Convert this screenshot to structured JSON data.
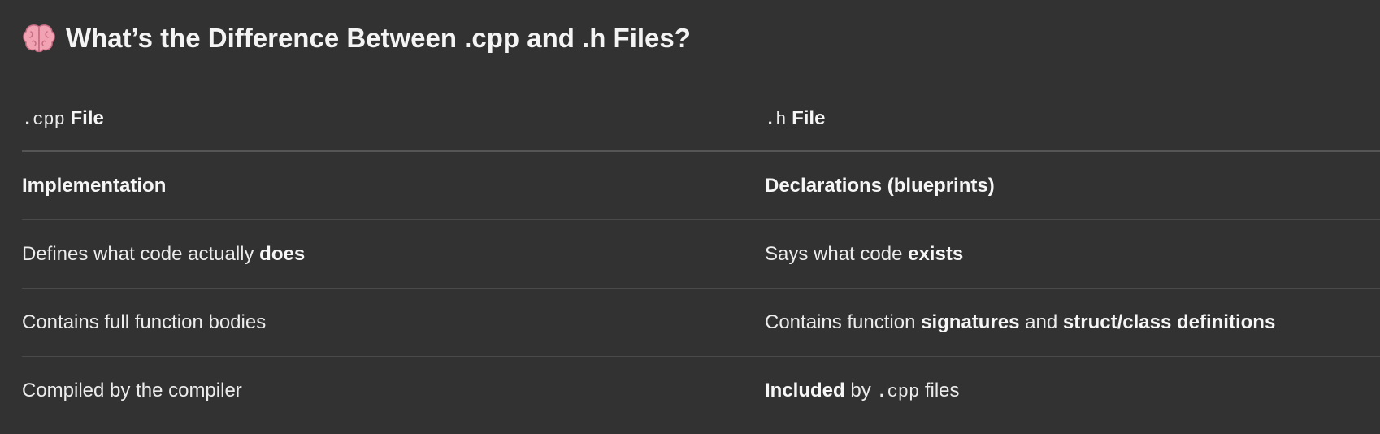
{
  "heading": {
    "icon": "brain-emoji",
    "title": "What’s the Difference Between .cpp and .h Files?"
  },
  "table": {
    "header": {
      "cpp": {
        "code_dot": ".",
        "code": "cpp",
        "label": "File"
      },
      "h": {
        "code_dot": ".",
        "code": "h",
        "label": "File"
      }
    },
    "rows": [
      {
        "cpp": {
          "bold": "Implementation"
        },
        "h": {
          "bold": "Declarations (blueprints)"
        }
      },
      {
        "cpp": {
          "text": "Defines what code actually ",
          "bold": "does"
        },
        "h": {
          "text": "Says what code ",
          "bold": "exists"
        }
      },
      {
        "cpp": {
          "text": "Contains full function bodies"
        },
        "h": {
          "text": "Contains function ",
          "bold1": "signatures",
          "mid": " and ",
          "bold2": "struct/class definitions"
        }
      },
      {
        "cpp": {
          "text": "Compiled by the compiler"
        },
        "h": {
          "bold": "Included",
          "text": " by ",
          "code_dot": ".",
          "code": "cpp",
          "tail": " files"
        }
      }
    ]
  }
}
